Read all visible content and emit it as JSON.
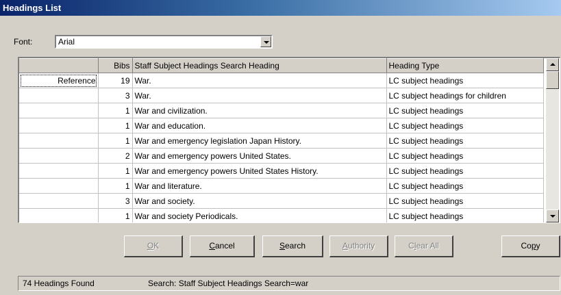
{
  "window": {
    "title": "Headings List"
  },
  "font": {
    "label": "Font:",
    "value": "Arial"
  },
  "grid": {
    "columns": [
      "",
      "Bibs",
      "Staff Subject Headings Search Heading",
      "Heading Type"
    ],
    "rows": [
      {
        "ref": "Reference",
        "bibs": "19",
        "heading": "War.",
        "type": "LC subject headings"
      },
      {
        "ref": "",
        "bibs": "3",
        "heading": "War.",
        "type": "LC subject headings for children"
      },
      {
        "ref": "",
        "bibs": "1",
        "heading": "War and civilization.",
        "type": "LC subject headings"
      },
      {
        "ref": "",
        "bibs": "1",
        "heading": "War and education.",
        "type": "LC subject headings"
      },
      {
        "ref": "",
        "bibs": "1",
        "heading": "War and emergency legislation Japan History.",
        "type": "LC subject headings"
      },
      {
        "ref": "",
        "bibs": "2",
        "heading": "War and emergency powers United States.",
        "type": "LC subject headings"
      },
      {
        "ref": "",
        "bibs": "1",
        "heading": "War and emergency powers United States History.",
        "type": "LC subject headings"
      },
      {
        "ref": "",
        "bibs": "1",
        "heading": "War and literature.",
        "type": "LC subject headings"
      },
      {
        "ref": "",
        "bibs": "3",
        "heading": "War and society.",
        "type": "LC subject headings"
      },
      {
        "ref": "",
        "bibs": "1",
        "heading": "War and society Periodicals.",
        "type": "LC subject headings"
      }
    ]
  },
  "buttons": {
    "ok": {
      "mnemonic": "O",
      "rest": "K",
      "enabled": false
    },
    "cancel": {
      "mnemonic": "C",
      "rest": "ancel",
      "enabled": true
    },
    "search": {
      "mnemonic": "S",
      "rest": "earch",
      "enabled": true
    },
    "authority": {
      "mnemonic": "A",
      "rest": "uthority",
      "enabled": false
    },
    "clear_all": {
      "pre": "C",
      "mnemonic": "l",
      "rest": "ear All",
      "enabled": false
    },
    "copy": {
      "pre": "Co",
      "mnemonic": "p",
      "rest": "y",
      "enabled": true
    }
  },
  "status": {
    "count": "74 Headings Found",
    "search": "Search: Staff Subject Headings Search=war"
  },
  "icons": [
    "chevron-down-icon",
    "scroll-up-icon",
    "scroll-down-icon"
  ]
}
